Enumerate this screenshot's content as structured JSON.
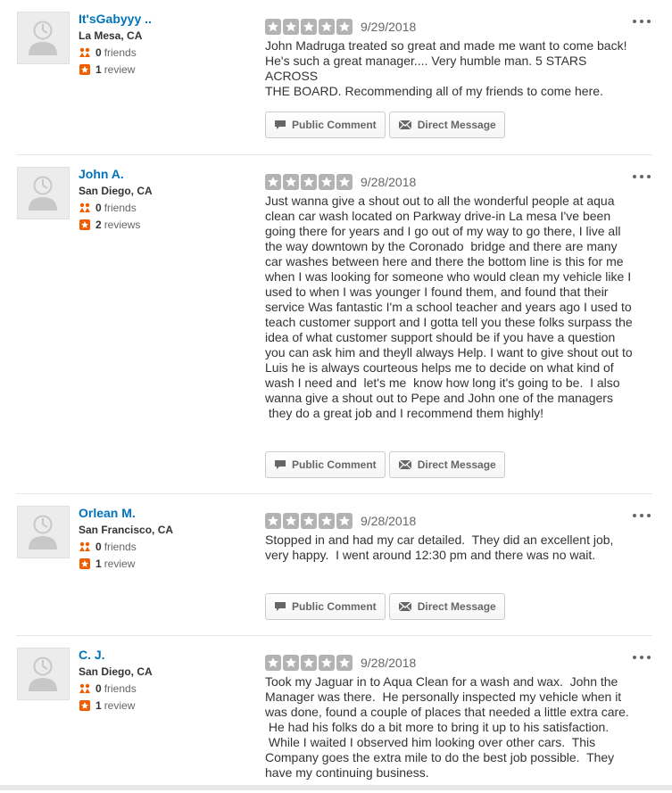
{
  "reviews": [
    {
      "name": "It'sGabyyy ..",
      "location": "La Mesa, CA",
      "friends": "0",
      "friends_label": "friends",
      "reviews_count": "1",
      "reviews_label": "review",
      "rating": 5,
      "date": "9/29/2018",
      "text": "John Madruga treated so great and made me want to come back!\nHe's such a great manager.... Very humble man. 5 STARS ACROSS\nTHE BOARD. Recommending all of my friends to come here."
    },
    {
      "name": "John A.",
      "location": "San Diego, CA",
      "friends": "0",
      "friends_label": "friends",
      "reviews_count": "2",
      "reviews_label": "reviews",
      "rating": 5,
      "date": "9/28/2018",
      "text": "Just wanna give a shout out to all the wonderful people at aqua\nclean car wash located on Parkway drive-in La mesa I've been\ngoing there for years and I go out of my way to go there, I live all\nthe way downtown by the Coronado  bridge and there are many\ncar washes between here and there the bottom line is this for me\nwhen I was looking for someone who would clean my vehicle like I\nused to when I was younger I found them, and found that their\nservice Was fantastic I'm a school teacher and years ago I used to\nteach customer support and I gotta tell you these folks surpass the\nidea of what customer support should be if you have a question\nyou can ask him and theyll always Help. I want to give shout out to\nLuis he is always courteous helps me to decide on what kind of\nwash I need and  let's me  know how long it's going to be.  I also\nwanna give a shout out to Pepe and John one of the managers\n they do a great job and I recommend them highly!"
    },
    {
      "name": "Orlean M.",
      "location": "San Francisco, CA",
      "friends": "0",
      "friends_label": "friends",
      "reviews_count": "1",
      "reviews_label": "review",
      "rating": 5,
      "date": "9/28/2018",
      "text": "Stopped in and had my car detailed.  They did an excellent job,\nvery happy.  I went around 12:30 pm and there was no wait."
    },
    {
      "name": "C. J.",
      "location": "San Diego, CA",
      "friends": "0",
      "friends_label": "friends",
      "reviews_count": "1",
      "reviews_label": "review",
      "rating": 5,
      "date": "9/28/2018",
      "text": "Took my Jaguar in to Aqua Clean for a wash and wax.  John the\nManager was there.  He personally inspected my vehicle when it\nwas done, found a couple of places that needed a little extra care.\n He had his folks do a bit more to bring it up to his satisfaction.\n While I waited I observed him looking over other cars.  This\nCompany goes the extra mile to do the best job possible.  They\nhave my continuing business."
    }
  ],
  "actions": {
    "public_comment": "Public Comment",
    "direct_message": "Direct Message"
  },
  "colors": {
    "user_link": "#0073bb",
    "star_gray": "#b3b3b3",
    "review_badge": "#f15c00"
  }
}
